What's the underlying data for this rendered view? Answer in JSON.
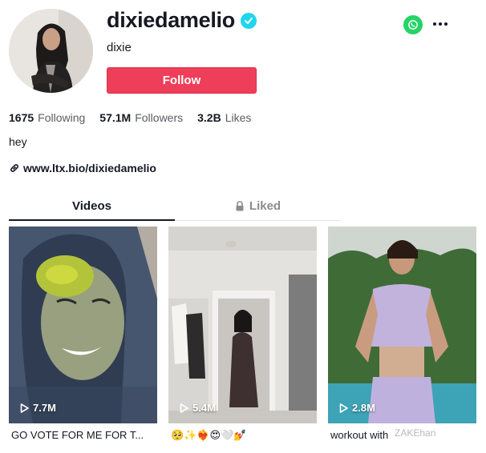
{
  "profile": {
    "username": "dixiedamelio",
    "display_name": "dixie",
    "follow_label": "Follow",
    "bio": "hey",
    "link": "www.ltx.bio/dixiedamelio",
    "accent_color": "#ee3e5a",
    "verified_color": "#20d5ec"
  },
  "stats": [
    {
      "value": "1675",
      "label": "Following"
    },
    {
      "value": "57.1M",
      "label": "Followers"
    },
    {
      "value": "3.2B",
      "label": "Likes"
    }
  ],
  "tabs": [
    {
      "label": "Videos",
      "active": true
    },
    {
      "label": "Liked",
      "active": false,
      "icon": "lock-icon"
    }
  ],
  "videos": [
    {
      "views": "7.7M",
      "caption": "GO VOTE FOR ME FOR T..."
    },
    {
      "views": "5.4M",
      "caption": "🥺✨❤️‍🔥😍🤍💅"
    },
    {
      "views": "2.8M",
      "caption": "workout with"
    }
  ],
  "icons": {
    "share": "whatsapp-icon",
    "more": "more-options-icon",
    "link": "link-icon",
    "play": "play-icon"
  },
  "watermark": "ZAKEhan"
}
